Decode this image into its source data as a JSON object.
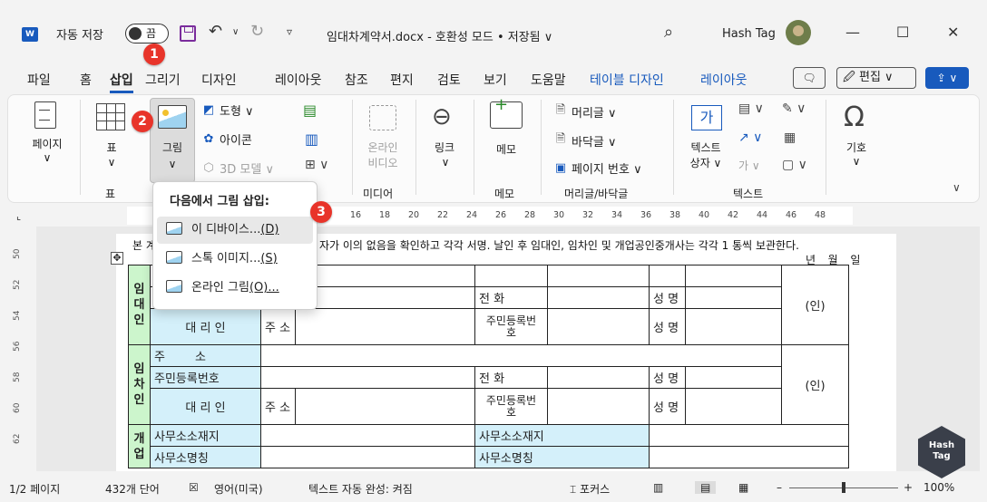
{
  "titlebar": {
    "app_icon": "word-icon",
    "autosave_label": "자동 저장",
    "autosave_state": "끔",
    "doc_title": "임대차계약서.docx  -  호환성 모드 • 저장됨 ∨",
    "user_name": "Hash Tag",
    "min": "—",
    "max": "☐",
    "close": "✕"
  },
  "tabs": [
    "파일",
    "홈",
    "삽입",
    "그리기",
    "디자인",
    "레이아웃",
    "참조",
    "편지",
    "검토",
    "보기",
    "도움말",
    "테이블 디자인",
    "레이아웃"
  ],
  "tab_actions": {
    "comment": "🗨",
    "edit": "🖉 편집 ∨",
    "share": "⇪ ∨"
  },
  "ribbon": {
    "page_label": "페이지\n∨",
    "table_label": "표",
    "table_group": "표",
    "picture_label": "그림",
    "shapes": "도형 ∨",
    "icons": "아이콘",
    "models3d": "3D 모델 ∨",
    "online_video": "온라인\n비디오",
    "media_group": "미디어",
    "link": "링크",
    "memo": "메모",
    "memo_group": "메모",
    "header": "머리글 ∨",
    "footer": "바닥글 ∨",
    "page_number": "페이지 번호 ∨",
    "hf_group": "머리글/바닥글",
    "textbox": "텍스트\n상자 ∨",
    "text_group": "텍스트",
    "equation": "기호\n∨"
  },
  "dropdown": {
    "title": "다음에서 그림 삽입:",
    "items": [
      {
        "label": "이 디바이스...",
        "key": "(D)"
      },
      {
        "label": "스톡 이미지...",
        "key": "(S)"
      },
      {
        "label": "온라인 그림",
        "key": "(O)..."
      }
    ]
  },
  "badges": [
    "1",
    "2",
    "3"
  ],
  "ruler": {
    "numbers": [
      "16",
      "18",
      "20",
      "22",
      "24",
      "26",
      "28",
      "30",
      "32",
      "34",
      "36",
      "38",
      "40",
      "42",
      "44",
      "46",
      "48"
    ],
    "vertical": [
      "50",
      "52",
      "54",
      "56",
      "58",
      "60",
      "62"
    ]
  },
  "document": {
    "line1_prefix": "본 계",
    "line1": "자가 이의 없음을 확인하고 각각 서명. 날인 후 임대인, 임차인 및 개업공인중개사는 각각 1 통씩 보관한다.",
    "date": "년  월  일",
    "rows": {
      "lessor": "임\n대\n인",
      "lessee": "임\n차\n인",
      "agent": "개\n업",
      "phone": "전    화",
      "name": "성 명",
      "seal": "(인)",
      "agent_label": "대  리  인",
      "address_short": "주 소",
      "rrn_long": "주민등록번\n호",
      "address": "주        소",
      "rrn": "주민등록번호",
      "office_addr": "사무소소재지",
      "office_name": "사무소명칭"
    }
  },
  "statusbar": {
    "page": "1/2 페이지",
    "words": "432개 단어",
    "lang": "영어(미국)",
    "autocomplete": "텍스트 자동 완성: 켜짐",
    "focus": "포커스",
    "zoom": "100%"
  },
  "watermark": "Hash Tag"
}
